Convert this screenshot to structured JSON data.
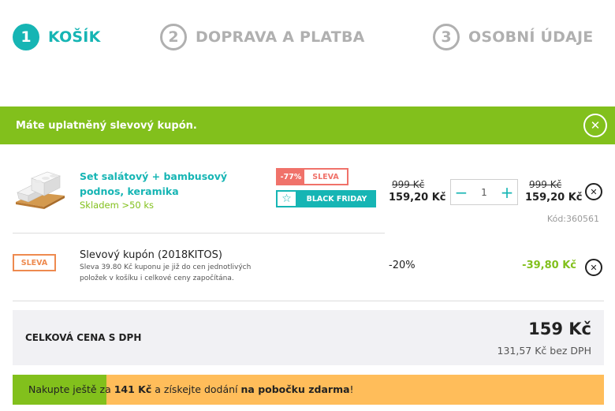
{
  "steps": [
    {
      "number": "1",
      "label": "KOŠÍK",
      "active": true
    },
    {
      "number": "2",
      "label": "DOPRAVA A PLATBA",
      "active": false
    },
    {
      "number": "3",
      "label": "OSOBNÍ ÚDAJE",
      "active": false
    }
  ],
  "banner": {
    "message": "Máte uplatněný slevový kupón.",
    "close_icon": "close-icon",
    "color": "#82c01c"
  },
  "product": {
    "name": "Set salátový + bambusový podnos, keramika",
    "stock": "Skladem >50 ks",
    "badge_discount_pct": "-77%",
    "badge_discount_label": "SLEVA",
    "badge_bf_label": "BLACK FRIDAY",
    "unit_old_price": "999 Kč",
    "unit_price": "159,20 Kč",
    "quantity": "1",
    "total_old_price": "999 Kč",
    "total_price": "159,20 Kč",
    "code": "Kód:360561"
  },
  "coupon": {
    "badge": "SLEVA",
    "name": "Slevový kupón (2018KITOS)",
    "description": "Sleva 39.80 Kč kuponu je již do cen jednotlivých položek v košíku i celkové ceny započítána.",
    "percent": "-20%",
    "amount": "-39,80 Kč"
  },
  "total": {
    "label": "CELKOVÁ CENA S DPH",
    "price": "159 Kč",
    "net": "131,57 Kč bez DPH"
  },
  "shipping": {
    "prefix": "Nakupte ještě za ",
    "amount": "141 Kč",
    "middle": " a získejte dodání ",
    "target": "na pobočku zdarma",
    "suffix": "!",
    "progress_fraction": 0.158
  },
  "colors": {
    "accent": "#16b5b4",
    "green": "#82c01c",
    "discount_red": "#f0726a",
    "coupon_orange": "#ee8a4f",
    "shipping_orange": "#ffbd5a"
  }
}
